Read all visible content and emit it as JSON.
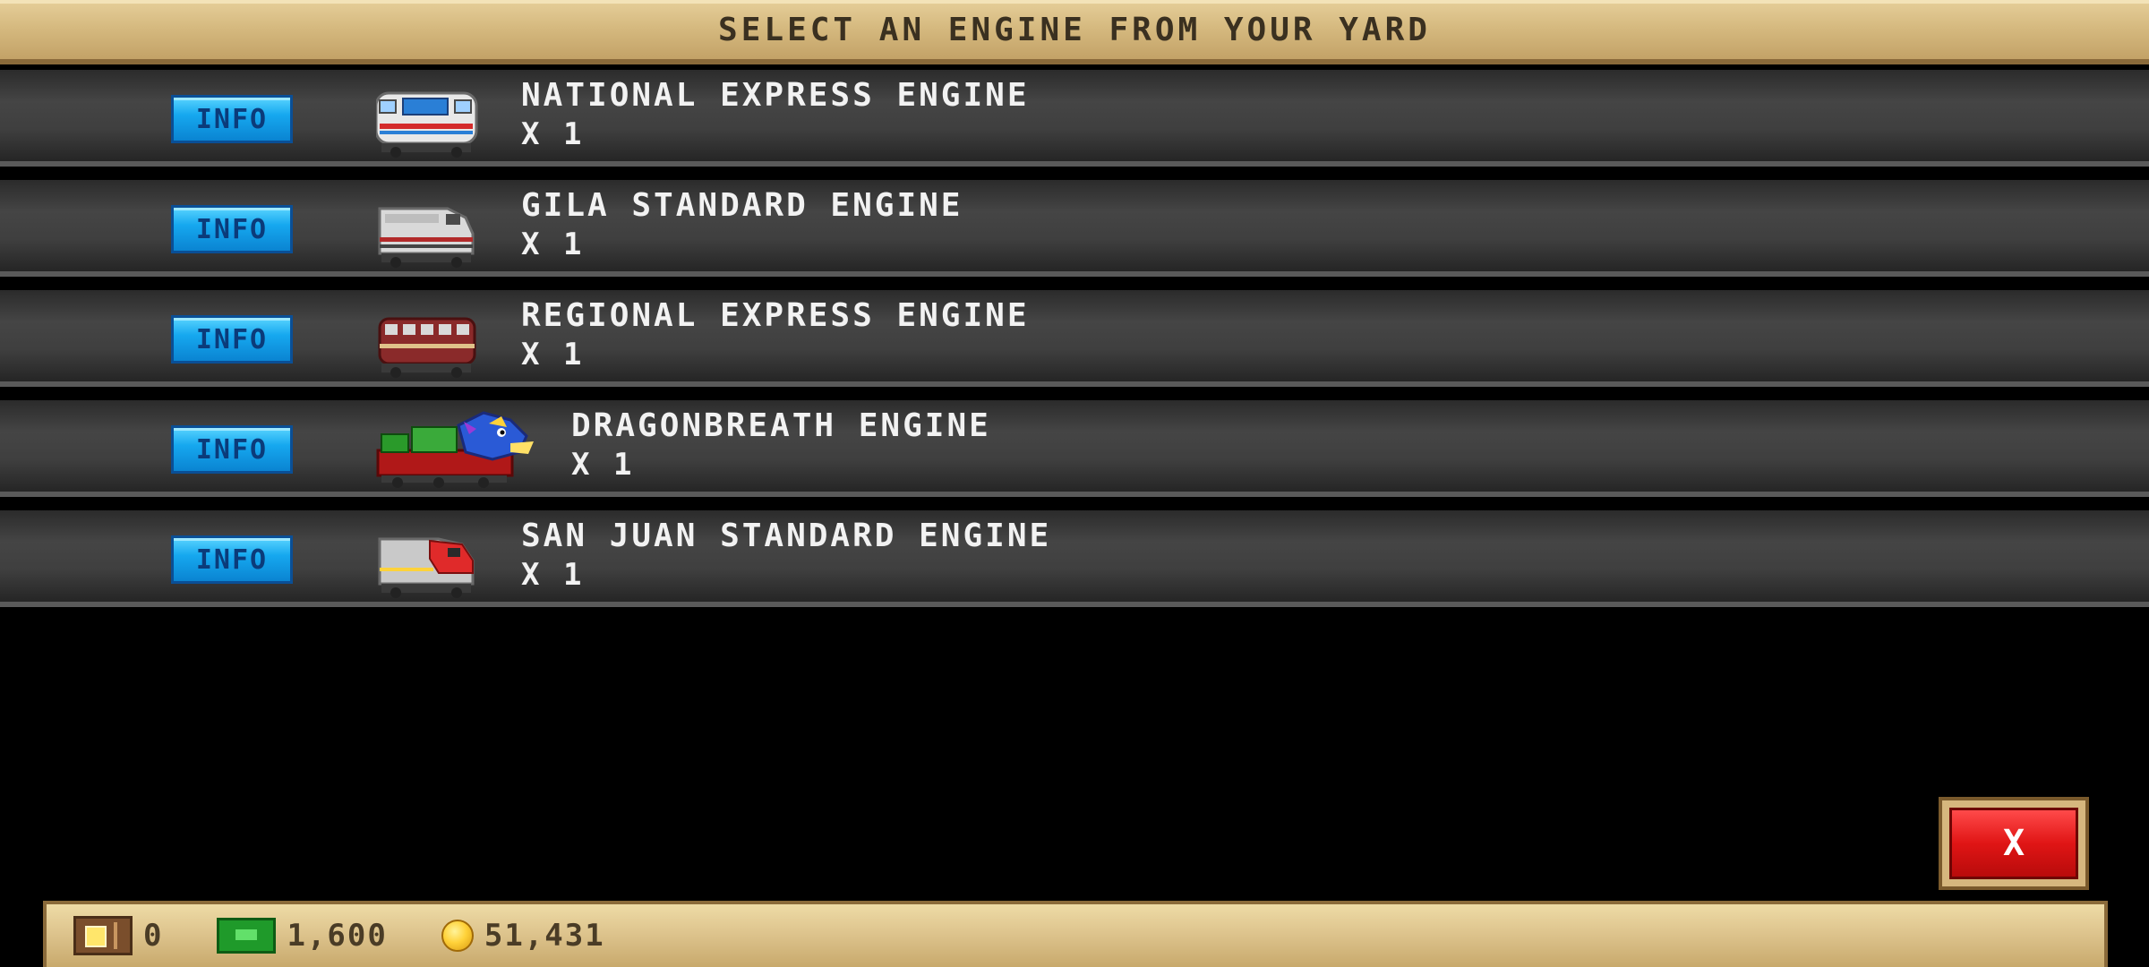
{
  "header": {
    "title": "SELECT AN ENGINE FROM YOUR YARD"
  },
  "engines": [
    {
      "info_label": "INFO",
      "name": "NATIONAL EXPRESS ENGINE",
      "count": "X 1",
      "icon": "national-express-engine-icon"
    },
    {
      "info_label": "INFO",
      "name": "GILA STANDARD ENGINE",
      "count": "X 1",
      "icon": "gila-standard-engine-icon"
    },
    {
      "info_label": "INFO",
      "name": "REGIONAL EXPRESS ENGINE",
      "count": "X 1",
      "icon": "regional-express-engine-icon"
    },
    {
      "info_label": "INFO",
      "name": "DRAGONBREATH ENGINE",
      "count": "X 1",
      "icon": "dragonbreath-engine-icon"
    },
    {
      "info_label": "INFO",
      "name": "SAN JUAN STANDARD ENGINE",
      "count": "X 1",
      "icon": "san-juan-standard-engine-icon"
    }
  ],
  "close_button": {
    "label": "X"
  },
  "status_bar": {
    "tickets": "0",
    "cash": "1,600",
    "coins": "51,431"
  },
  "colors": {
    "header_bg": "#d6ba80",
    "row_bg": "#3f3f3f",
    "info_button": "#16a8ef",
    "close_button": "#e01515",
    "status_bar_bg": "#dcc28b"
  }
}
